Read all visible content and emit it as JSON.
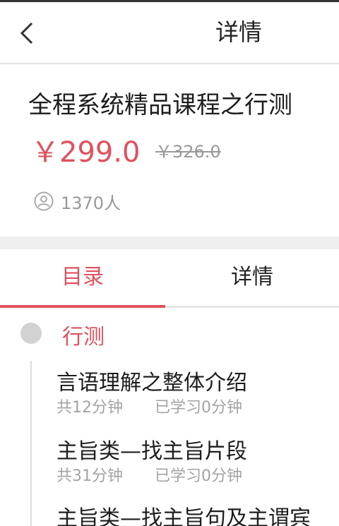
{
  "nav": {
    "back_icon": "chevron-left-icon",
    "title": "详情"
  },
  "course": {
    "title": "全程系统精品课程之行测",
    "price": "￥299.0",
    "original_price": "￥326.0",
    "students_icon": "user-circle-icon",
    "students": "1370人"
  },
  "tabs": [
    {
      "label": "目录",
      "active": true
    },
    {
      "label": "详情",
      "active": false
    }
  ],
  "catalog": {
    "chapter": "行测",
    "lessons": [
      {
        "title": "言语理解之整体介绍",
        "duration": "共12分钟",
        "learned": "已学习0分钟"
      },
      {
        "title": "主旨类—找主旨片段",
        "duration": "共31分钟",
        "learned": "已学习0分钟"
      },
      {
        "title": "主旨类—找主旨句及主谓宾",
        "duration": "",
        "learned": ""
      }
    ]
  },
  "colors": {
    "accent": "#e0515e",
    "muted": "#999999",
    "divider": "#e6e6e6"
  }
}
